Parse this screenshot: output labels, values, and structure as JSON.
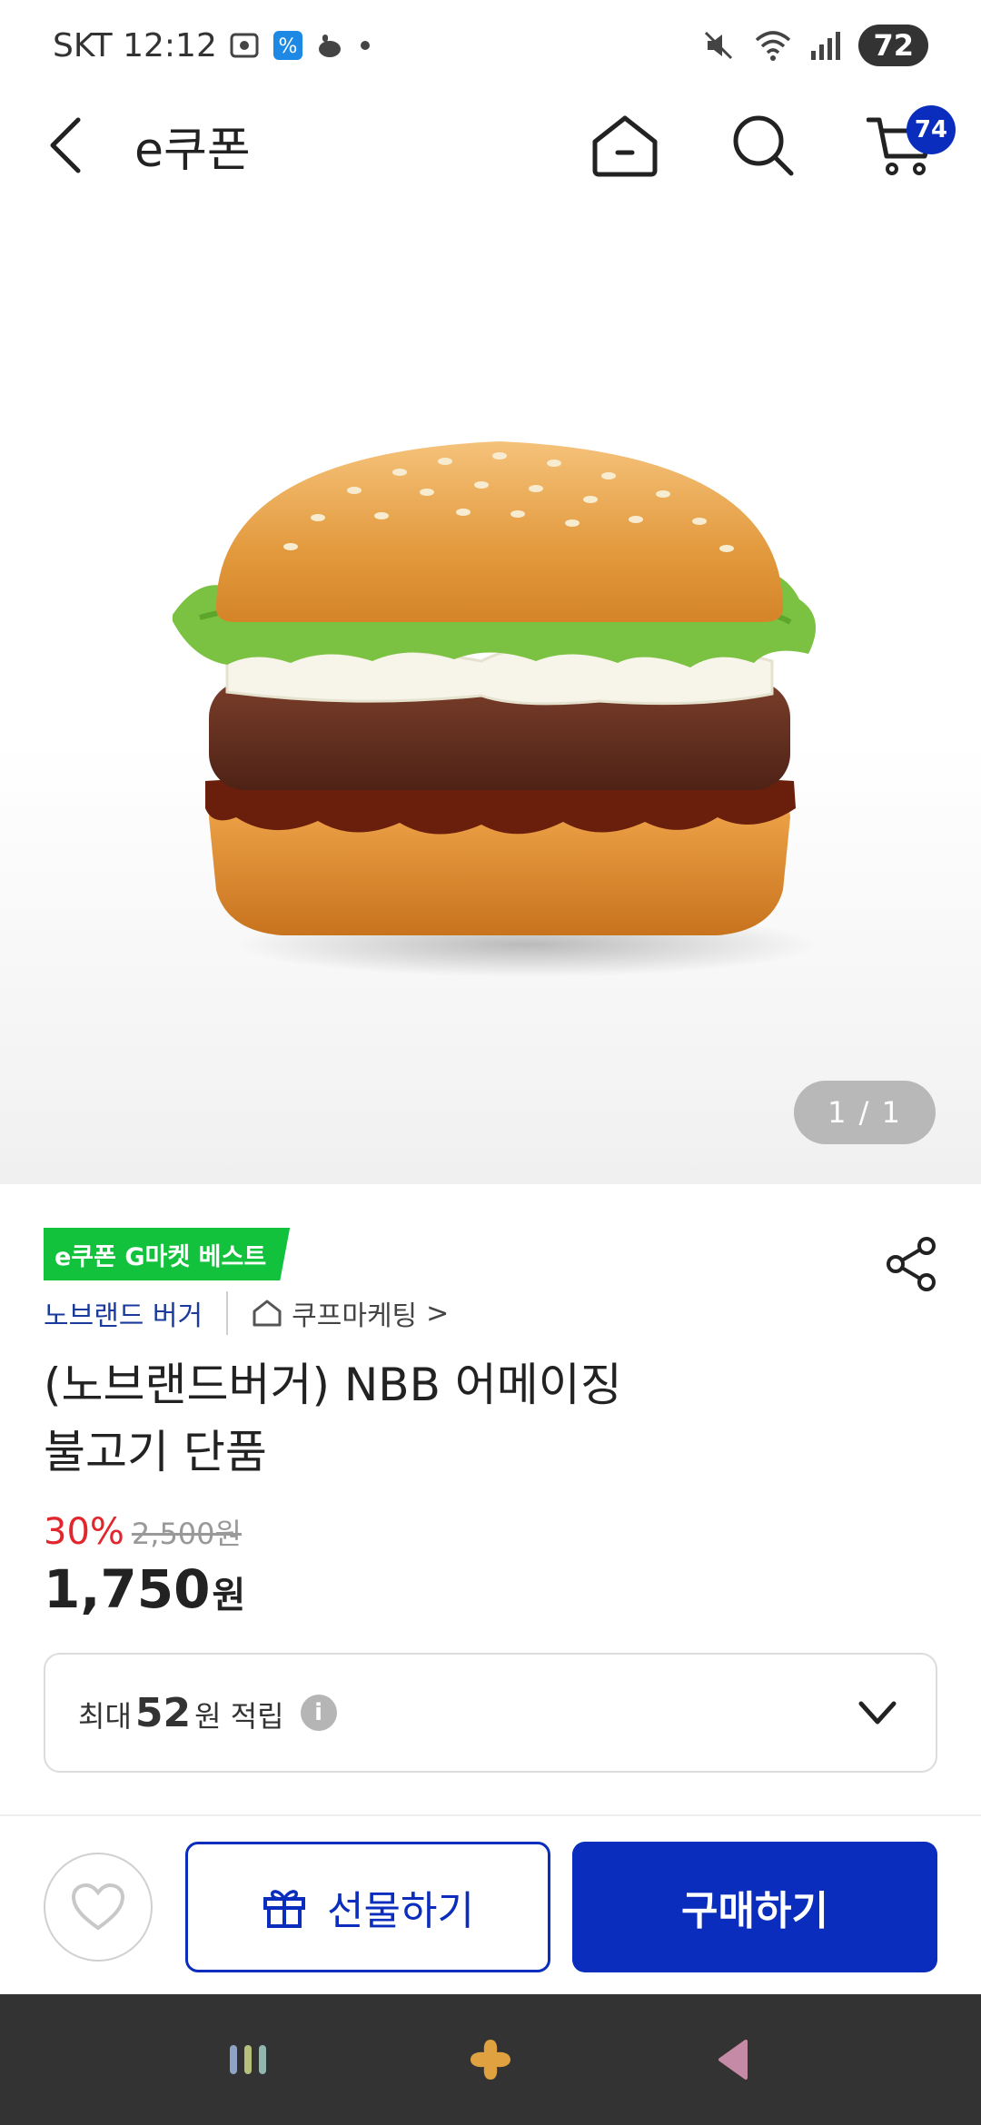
{
  "status_bar": {
    "carrier_time": "SKT 12:12",
    "battery": "72"
  },
  "header": {
    "title": "e쿠폰",
    "cart_count": "74"
  },
  "image": {
    "counter": "1 / 1"
  },
  "product": {
    "badge": "e쿠폰 G마켓 베스트",
    "brand": "노브랜드 버거",
    "seller": "쿠프마케팅",
    "seller_chevron": ">",
    "title_line1": "(노브랜드버거) NBB 어메이징",
    "title_line2": "불고기 단품",
    "discount": "30%",
    "original_price": "2,500원",
    "price": "1,750",
    "price_unit": "원"
  },
  "points": {
    "prefix": "최대",
    "amount": "52",
    "suffix": "원 적립",
    "info": "i"
  },
  "actions": {
    "gift_label": "선물하기",
    "buy_label": "구매하기"
  },
  "colors": {
    "brand_blue": "#0a2dbd",
    "discount_red": "#e1262d",
    "best_green": "#12c13c"
  }
}
